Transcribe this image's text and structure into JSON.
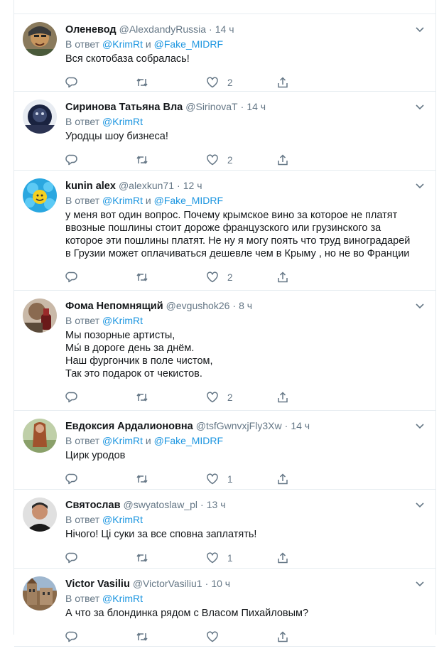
{
  "reply_prefix": "В ответ",
  "and_word": "и",
  "dot": "·",
  "tweets": [
    {
      "name": "Оленевод",
      "handle": "@AlexdandyRussia",
      "time": "14 ч",
      "reply_to": [
        "@KrimRt",
        "@Fake_MIDRF"
      ],
      "text": "Вся скотобаза собралась!",
      "likes": "2"
    },
    {
      "name": "Сиринова Татьяна Вла",
      "handle": "@SirinovaT",
      "time": "14 ч",
      "reply_to": [
        "@KrimRt"
      ],
      "text": "Уродцы шоу бизнеса!",
      "likes": "2"
    },
    {
      "name": "kunin alex",
      "handle": "@alexkun71",
      "time": "12 ч",
      "reply_to": [
        "@KrimRt",
        "@Fake_MIDRF"
      ],
      "text": "у меня вот один вопрос. Почему крымское вино за которое не платят\nввозные пошлины стоит дороже французского или грузинского за\nкоторое эти пошлины платят. Не ну я могу поять что труд виноградарей\nв Грузии может оплачиваться дешевле чем в Крыму , но не во Франции",
      "likes": "2"
    },
    {
      "name": "Фома Непомнящий",
      "handle": "@evgushok26",
      "time": "8 ч",
      "reply_to": [
        "@KrimRt"
      ],
      "text": "Мы позорные артисты,\nМы́ в дороге день за днём.\nНаш фургончик в поле чистом,\nТак это подарок от чекистов.",
      "likes": "2"
    },
    {
      "name": "Евдоксия Ардалионовна",
      "handle": "@tsfGwnvxjFly3Xw",
      "time": "14 ч",
      "reply_to": [
        "@KrimRt",
        "@Fake_MIDRF"
      ],
      "text": "Цирк уродов",
      "likes": "1"
    },
    {
      "name": "Святослав",
      "handle": "@swyatoslaw_pl",
      "time": "13 ч",
      "reply_to": [
        "@KrimRt"
      ],
      "text": "Нiчого! Цi суки за все сповна заплатять!",
      "likes": "1"
    },
    {
      "name": "Victor Vasiliu",
      "handle": "@VictorVasiliu1",
      "time": "10 ч",
      "reply_to": [
        "@KrimRt"
      ],
      "text": "А что за блондинка рядом с Власом Пихайловым?",
      "likes": ""
    }
  ],
  "icons": {
    "reply": "reply-icon",
    "retweet": "retweet-icon",
    "like": "heart-icon",
    "share": "share-icon",
    "caret": "chevron-down-icon"
  },
  "colors": {
    "link": "#1b95e0",
    "muted": "#657786",
    "text": "#14171a",
    "border": "#e6ecf0"
  }
}
